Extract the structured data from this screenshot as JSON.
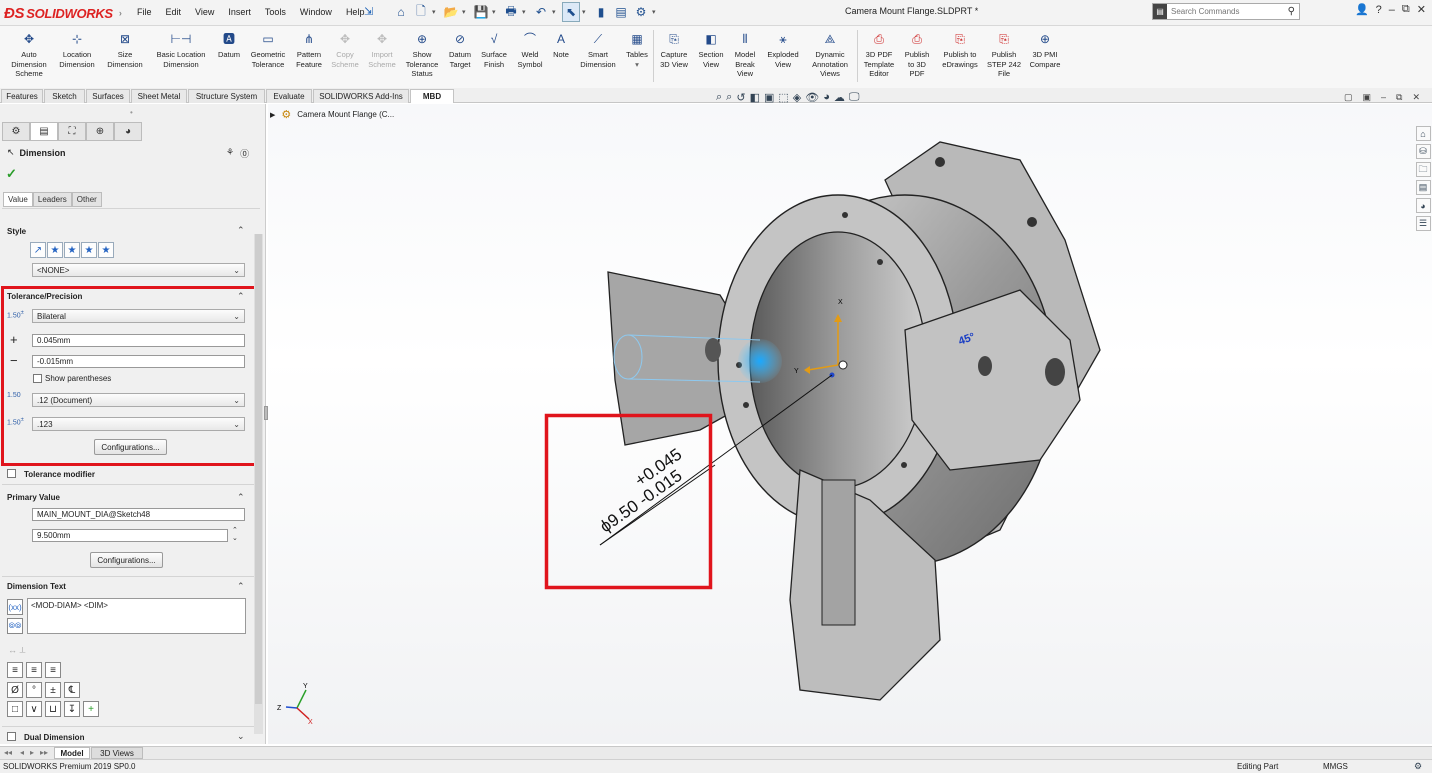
{
  "app": {
    "logo": "SOLIDWORKS",
    "document_title": "Camera Mount Flange.SLDPRT *",
    "search_placeholder": "Search Commands"
  },
  "menu": [
    "File",
    "Edit",
    "View",
    "Insert",
    "Tools",
    "Window",
    "Help"
  ],
  "ribbon": [
    {
      "label": "Auto\nDimension\nScheme",
      "icon": "auto-dimension-icon"
    },
    {
      "label": "Location\nDimension",
      "icon": "location-dimension-icon"
    },
    {
      "label": "Size\nDimension",
      "icon": "size-dimension-icon"
    },
    {
      "label": "Basic Location\nDimension",
      "icon": "basic-location-icon"
    },
    {
      "label": "Datum",
      "icon": "datum-icon"
    },
    {
      "label": "Geometric\nTolerance",
      "icon": "geometric-tolerance-icon"
    },
    {
      "label": "Pattern\nFeature",
      "icon": "pattern-feature-icon"
    },
    {
      "label": "Copy\nScheme",
      "icon": "copy-scheme-icon",
      "disabled": true
    },
    {
      "label": "Import\nScheme",
      "icon": "import-scheme-icon",
      "disabled": true
    },
    {
      "label": "Show\nTolerance\nStatus",
      "icon": "tolerance-status-icon"
    },
    {
      "label": "Datum\nTarget",
      "icon": "datum-target-icon"
    },
    {
      "label": "Surface\nFinish",
      "icon": "surface-finish-icon"
    },
    {
      "label": "Weld\nSymbol",
      "icon": "weld-symbol-icon"
    },
    {
      "label": "Note",
      "icon": "note-icon"
    },
    {
      "label": "Smart\nDimension",
      "icon": "smart-dimension-icon"
    },
    {
      "label": "Tables",
      "icon": "tables-icon"
    },
    {
      "label": "Capture\n3D View",
      "icon": "capture-view-icon"
    },
    {
      "label": "Section\nView",
      "icon": "section-view-icon"
    },
    {
      "label": "Model\nBreak\nView",
      "icon": "model-break-icon"
    },
    {
      "label": "Exploded\nView",
      "icon": "exploded-view-icon"
    },
    {
      "label": "Dynamic\nAnnotation\nViews",
      "icon": "dynamic-annotation-icon"
    },
    {
      "label": "3D PDF\nTemplate\nEditor",
      "icon": "pdf-template-icon"
    },
    {
      "label": "Publish\nto 3D\nPDF",
      "icon": "publish-pdf-icon"
    },
    {
      "label": "Publish to\neDrawings",
      "icon": "publish-edrawings-icon"
    },
    {
      "label": "Publish\nSTEP 242\nFile",
      "icon": "publish-step-icon"
    },
    {
      "label": "3D PMI\nCompare",
      "icon": "pmi-compare-icon"
    }
  ],
  "tabs": [
    "Features",
    "Sketch",
    "Surfaces",
    "Sheet Metal",
    "Structure System",
    "Evaluate",
    "SOLIDWORKS Add-Ins",
    "MBD"
  ],
  "active_tab": "MBD",
  "tree_root": "Camera Mount Flange  (C...",
  "property_manager": {
    "title": "Dimension",
    "subtabs": [
      "Value",
      "Leaders",
      "Other"
    ],
    "style": {
      "title": "Style",
      "value": "<NONE>"
    },
    "tolerance": {
      "title": "Tolerance/Precision",
      "type": "Bilateral",
      "plus": "0.045mm",
      "minus": "-0.015mm",
      "show_parentheses": "Show parentheses",
      "primary_precision": ".12 (Document)",
      "tolerance_precision": ".123",
      "configurations": "Configurations..."
    },
    "tolerance_modifier": "Tolerance modifier",
    "primary_value": {
      "title": "Primary Value",
      "name": "MAIN_MOUNT_DIA@Sketch48",
      "value": "9.500mm",
      "configurations": "Configurations..."
    },
    "dimension_text": {
      "title": "Dimension Text",
      "text": "<MOD-DIAM> <DIM>"
    },
    "dual_dimension": "Dual Dimension",
    "symbols": [
      "Ø",
      "°",
      "±",
      "℄"
    ]
  },
  "annotation": {
    "plus": "+0.045",
    "main": "ϕ9.50 -0.015",
    "angle": "45°"
  },
  "triad": {
    "x": "X",
    "y": "Y",
    "z": "Z"
  },
  "bottom_tabs": [
    "Model",
    "3D Views"
  ],
  "status": {
    "left": "SOLIDWORKS Premium 2019 SP0.0",
    "mode": "Editing Part",
    "units": "MMGS"
  }
}
